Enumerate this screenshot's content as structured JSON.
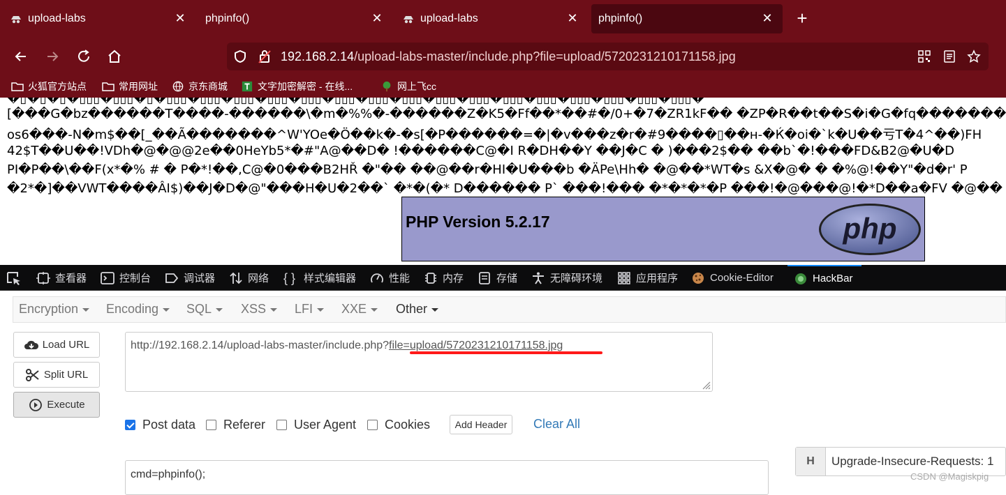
{
  "tabs": [
    {
      "label": "upload-labs",
      "icon": "incognito-icon"
    },
    {
      "label": "phpinfo()",
      "icon": ""
    },
    {
      "label": "upload-labs",
      "icon": "incognito-icon"
    },
    {
      "label": "phpinfo()",
      "icon": "",
      "active": true
    }
  ],
  "nav": {
    "url_host": "192.168.2.14",
    "url_path": "/upload-labs-master/include.php?file=upload/5720231210171158.jpg"
  },
  "bookmarks": [
    {
      "label": "火狐官方站点",
      "icon": "folder-icon"
    },
    {
      "label": "常用网址",
      "icon": "folder-icon"
    },
    {
      "label": "京东商城",
      "icon": "globe-icon"
    },
    {
      "label": "文字加密解密 - 在线...",
      "icon": "text-icon"
    },
    {
      "label": "网上飞cc",
      "icon": "tree-icon"
    }
  ],
  "page": {
    "garbage_lines": [
      "�▯�▯�▯�▯▯▯�▯▯▯�▯�▯▯▯�▯▯▯�▯▯▯�▯▯▯�▯▯▯�▯▯▯�▯▯▯�▯▯▯�▯▯▯�▯▯▯�▯▯▯�▯▯▯�▯▯▯�▯▯▯�▯▯▯�▯▯▯�",
      "[���G�bz������T����-������\\�m�%%�-������Z�K5�Ff��*��#�/0+�7�ZR1kF�� �ZP�R��t��S�i�G�fq�������",
      "os6���-N�m$��[_��Ã�������^W'YOe�Ö��k�-�s[�P������=�|�v���z�r�#9����▯��н-�Ќ�oi�`k�U��亏T�4^��)FH",
      "42$T��U��!VDh�@�@@2e��0HeYb5*�#\"A@��D� !������C@�I R�DH��Y ��J�C � )���2$�� ��b`�!���FD&B2@�U�D",
      "PI�P��\\��F(x*�%  # � P�*!��,C@�0���B2HŘ �\"�� ��@��r�HI�U���b �ÄPe\\Hh� �@��*WT�s &X�@� � �%@!��Y\"�d�r' P",
      "�2*�]��VWT����ÂI$)��J�D�@\"���H�U�2��` �*�(�* D������ P` ���!��� �*�*�*�P ���!�@���@!�*D��a�FV �@��"
    ],
    "php_version": "PHP Version 5.2.17",
    "php_logo_text": "php"
  },
  "devtools": {
    "tabs": [
      "查看器",
      "控制台",
      "调试器",
      "网络",
      "样式编辑器",
      "性能",
      "内存",
      "存储",
      "无障碍环境",
      "应用程序",
      "Cookie-Editor",
      "HackBar"
    ]
  },
  "hackbar": {
    "menu": [
      "Encryption",
      "Encoding",
      "SQL",
      "XSS",
      "LFI",
      "XXE",
      "Other"
    ],
    "buttons": {
      "load": "Load URL",
      "split": "Split URL",
      "execute": "Execute"
    },
    "url_prefix": "http://192.168.2.14/upload-labs-master/include.php?",
    "url_param": "file=upload/5720231210171158.jpg",
    "options": {
      "post_data": "Post data",
      "referer": "Referer",
      "user_agent": "User Agent",
      "cookies": "Cookies"
    },
    "add_header": "Add Header",
    "clear_all": "Clear All",
    "post_body": "cmd=phpinfo();",
    "header_key": "H",
    "header_value": "Upgrade-Insecure-Requests: 1"
  },
  "watermark": "CSDN @Magiskpig"
}
